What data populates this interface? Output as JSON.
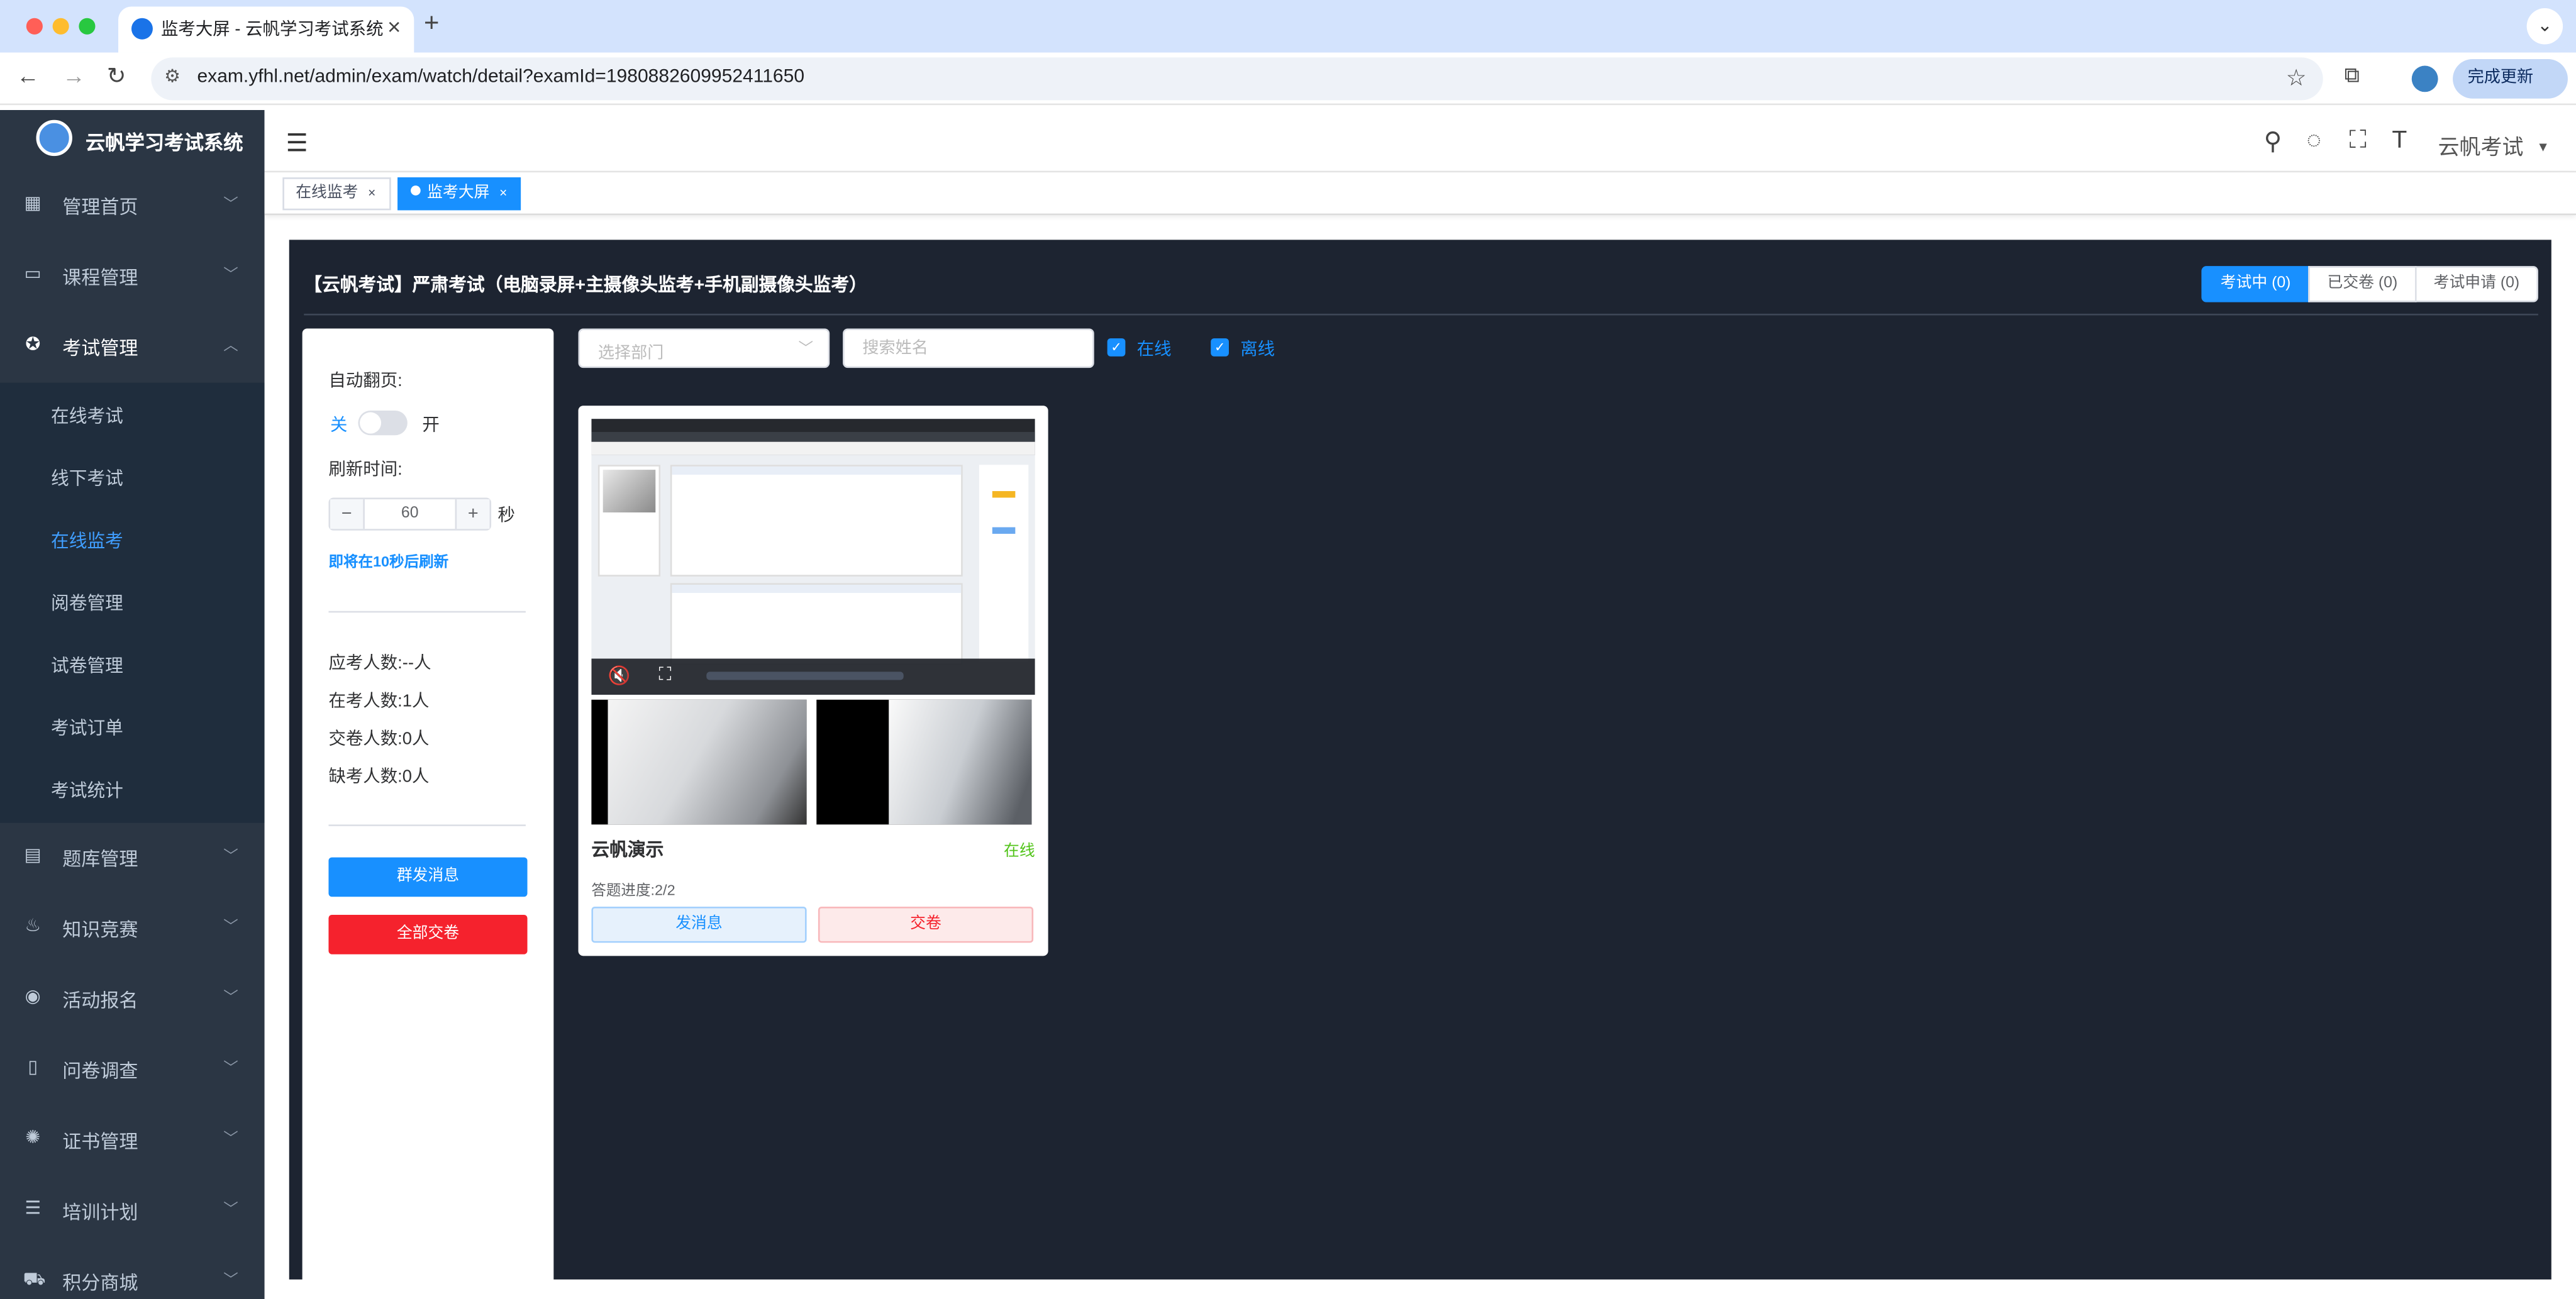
{
  "browser": {
    "tab_title": "监考大屏 - 云帆学习考试系统",
    "url": "exam.yfhl.net/admin/exam/watch/detail?examId=1980882609952411650",
    "update_label": "完成更新"
  },
  "sidebar": {
    "brand": "云帆学习考试系统",
    "menu": [
      {
        "label": "管理首页",
        "icon": "dashboard-icon"
      },
      {
        "label": "课程管理",
        "icon": "course-icon"
      },
      {
        "label": "考试管理",
        "icon": "exam-icon"
      },
      {
        "label": "题库管理",
        "icon": "question-bank-icon"
      },
      {
        "label": "知识竞赛",
        "icon": "fire-icon"
      },
      {
        "label": "活动报名",
        "icon": "activity-icon"
      },
      {
        "label": "问卷调查",
        "icon": "survey-icon"
      },
      {
        "label": "证书管理",
        "icon": "certificate-icon"
      },
      {
        "label": "培训计划",
        "icon": "plan-icon"
      },
      {
        "label": "积分商城",
        "icon": "cart-icon"
      }
    ],
    "exam_submenu": [
      "在线考试",
      "线下考试",
      "在线监考",
      "阅卷管理",
      "试卷管理",
      "考试订单",
      "考试统计"
    ],
    "active_submenu": "在线监考"
  },
  "header": {
    "user": "云帆考试"
  },
  "tags": [
    {
      "label": "在线监考",
      "active": false
    },
    {
      "label": "监考大屏",
      "active": true
    }
  ],
  "panel": {
    "title": "【云帆考试】严肃考试（电脑录屏+主摄像头监考+手机副摄像头监考）",
    "segments": [
      {
        "label": "考试中 (0)",
        "active": true
      },
      {
        "label": "已交卷 (0)",
        "active": false
      },
      {
        "label": "考试申请 (0)",
        "active": false
      }
    ]
  },
  "controls": {
    "auto_page_label": "自动翻页:",
    "switch_off": "关",
    "switch_on": "开",
    "auto_page_enabled": false,
    "refresh_label": "刷新时间:",
    "refresh_value": "60",
    "refresh_unit": "秒",
    "refresh_note": "即将在10秒后刷新",
    "stats": [
      {
        "label": "应考人数:",
        "value": "--人"
      },
      {
        "label": "在考人数:",
        "value": "1人"
      },
      {
        "label": "交卷人数:",
        "value": "0人"
      },
      {
        "label": "缺考人数:",
        "value": "0人"
      }
    ],
    "broadcast_button": "群发消息",
    "submit_all_button": "全部交卷"
  },
  "filters": {
    "department_placeholder": "选择部门",
    "name_placeholder": "搜索姓名",
    "online_label": "在线",
    "offline_label": "离线",
    "online_checked": true,
    "offline_checked": true
  },
  "students": [
    {
      "name": "云帆演示",
      "status": "在线",
      "progress": "答题进度:2/2",
      "message_button": "发消息",
      "submit_button": "交卷"
    }
  ],
  "colors": {
    "primary": "#1890ff",
    "danger": "#f5222d",
    "online": "#52c41a",
    "sidebar_bg": "#2b3644",
    "panel_bg": "#1d2431"
  }
}
